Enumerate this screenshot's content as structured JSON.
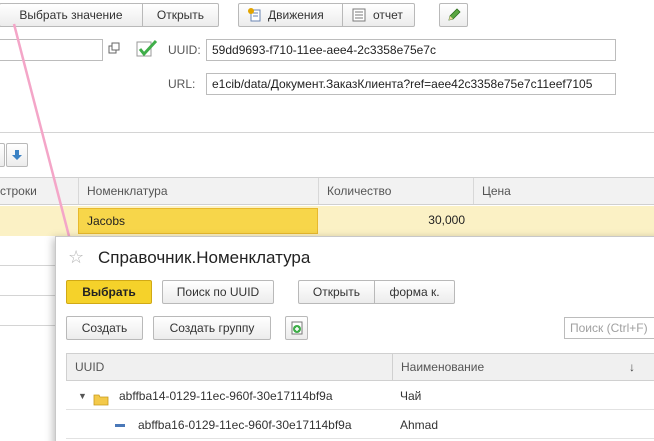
{
  "toolbar": {
    "select_value": "Выбрать значение",
    "open": "Открыть",
    "movements": "Движения",
    "report": "отчет"
  },
  "uuid": {
    "label": "UUID:",
    "value": "59dd9693-f710-11ee-aee4-2c3358e75e7c"
  },
  "url": {
    "label": "URL:",
    "value": "e1cib/data/Документ.ЗаказКлиента?ref=aee42c3358e75e7c11eef7105"
  },
  "grid": {
    "columns": [
      "строки",
      "Номенклатура",
      "Количество",
      "Цена"
    ],
    "row": {
      "nomenclature": "Jacobs",
      "quantity": "30,000"
    }
  },
  "popup": {
    "title": "Справочник.Номенклатура",
    "buttons": {
      "select": "Выбрать",
      "search_uuid": "Поиск по UUID",
      "open": "Открыть",
      "form": "форма к.",
      "create": "Создать",
      "create_group": "Создать группу"
    },
    "search_placeholder": "Поиск (Ctrl+F)",
    "columns": [
      "UUID",
      "Наименование"
    ],
    "sort_indicator": "↓",
    "rows": [
      {
        "uuid": "abffba14-0129-11ec-960f-30e17114bf9a",
        "name": "Чай"
      },
      {
        "uuid": "abffba16-0129-11ec-960f-30e17114bf9a",
        "name": "Ahmad"
      }
    ]
  },
  "colors": {
    "accent_yellow": "#f5d22a",
    "selection": "#fbf1c5",
    "check_green": "#3fae49"
  }
}
